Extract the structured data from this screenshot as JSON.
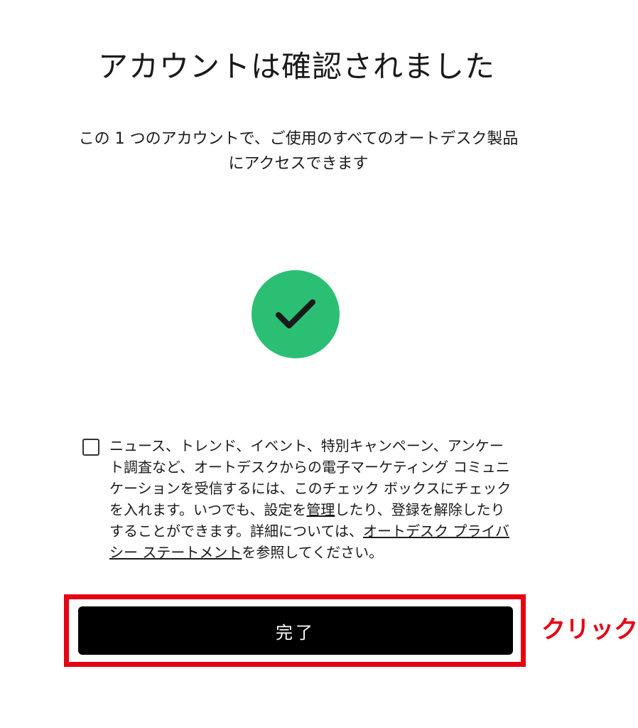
{
  "header": {
    "title": "アカウントは確認されました"
  },
  "message": {
    "text": "この 1 つのアカウントで、ご使用のすべてのオートデスク製品にアクセスできます"
  },
  "status": {
    "icon": "checkmark-icon",
    "color": "#2bbf73"
  },
  "consent": {
    "checked": false,
    "text_part1": "ニュース、トレンド、イベント、特別キャンペーン、アンケート調査など、オートデスクからの電子マーケティング コミュニケーションを受信するには、このチェック ボックスにチェックを入れます。いつでも、設定を",
    "manage_link": "管理",
    "text_part2": "したり、登録を解除したりすることができます。詳細については、",
    "privacy_link": "オートデスク プライバシー ステートメント",
    "text_part3": "を参照してください。"
  },
  "actions": {
    "done_label": "完了"
  },
  "annotation": {
    "label": "クリック",
    "color": "#e60012"
  }
}
